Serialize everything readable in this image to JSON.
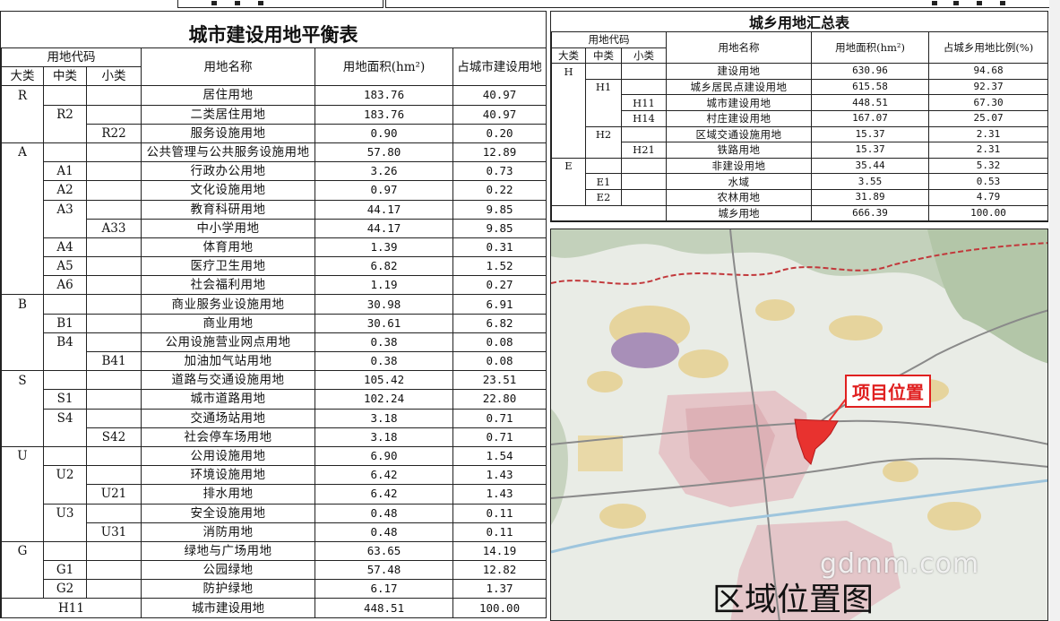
{
  "left_table": {
    "title": "城市建设用地平衡表",
    "header": {
      "code": "用地代码",
      "major": "大类",
      "medium": "中类",
      "minor": "小类",
      "name": "用地名称",
      "area": "用地面积(hm²)",
      "ratio": "占城市建设用地"
    },
    "rows": [
      {
        "major": "R",
        "medium": "",
        "minor": "",
        "name": "居住用地",
        "area": "183.76",
        "ratio": "40.97"
      },
      {
        "major": "",
        "medium": "R2",
        "minor": "",
        "name": "二类居住用地",
        "area": "183.76",
        "ratio": "40.97"
      },
      {
        "major": "",
        "medium": "",
        "minor": "R22",
        "name": "服务设施用地",
        "area": "0.90",
        "ratio": "0.20"
      },
      {
        "major": "A",
        "medium": "",
        "minor": "",
        "name": "公共管理与公共服务设施用地",
        "area": "57.80",
        "ratio": "12.89"
      },
      {
        "major": "",
        "medium": "A1",
        "minor": "",
        "name": "行政办公用地",
        "area": "3.26",
        "ratio": "0.73"
      },
      {
        "major": "",
        "medium": "A2",
        "minor": "",
        "name": "文化设施用地",
        "area": "0.97",
        "ratio": "0.22"
      },
      {
        "major": "",
        "medium": "A3",
        "minor": "",
        "name": "教育科研用地",
        "area": "44.17",
        "ratio": "9.85"
      },
      {
        "major": "",
        "medium": "",
        "minor": "A33",
        "name": "中小学用地",
        "area": "44.17",
        "ratio": "9.85"
      },
      {
        "major": "",
        "medium": "A4",
        "minor": "",
        "name": "体育用地",
        "area": "1.39",
        "ratio": "0.31"
      },
      {
        "major": "",
        "medium": "A5",
        "minor": "",
        "name": "医疗卫生用地",
        "area": "6.82",
        "ratio": "1.52"
      },
      {
        "major": "",
        "medium": "A6",
        "minor": "",
        "name": "社会福利用地",
        "area": "1.19",
        "ratio": "0.27"
      },
      {
        "major": "B",
        "medium": "",
        "minor": "",
        "name": "商业服务业设施用地",
        "area": "30.98",
        "ratio": "6.91"
      },
      {
        "major": "",
        "medium": "B1",
        "minor": "",
        "name": "商业用地",
        "area": "30.61",
        "ratio": "6.82"
      },
      {
        "major": "",
        "medium": "B4",
        "minor": "",
        "name": "公用设施营业网点用地",
        "area": "0.38",
        "ratio": "0.08"
      },
      {
        "major": "",
        "medium": "",
        "minor": "B41",
        "name": "加油加气站用地",
        "area": "0.38",
        "ratio": "0.08"
      },
      {
        "major": "S",
        "medium": "",
        "minor": "",
        "name": "道路与交通设施用地",
        "area": "105.42",
        "ratio": "23.51"
      },
      {
        "major": "",
        "medium": "S1",
        "minor": "",
        "name": "城市道路用地",
        "area": "102.24",
        "ratio": "22.80"
      },
      {
        "major": "",
        "medium": "S4",
        "minor": "",
        "name": "交通场站用地",
        "area": "3.18",
        "ratio": "0.71"
      },
      {
        "major": "",
        "medium": "",
        "minor": "S42",
        "name": "社会停车场用地",
        "area": "3.18",
        "ratio": "0.71"
      },
      {
        "major": "U",
        "medium": "",
        "minor": "",
        "name": "公用设施用地",
        "area": "6.90",
        "ratio": "1.54"
      },
      {
        "major": "",
        "medium": "U2",
        "minor": "",
        "name": "环境设施用地",
        "area": "6.42",
        "ratio": "1.43"
      },
      {
        "major": "",
        "medium": "",
        "minor": "U21",
        "name": "排水用地",
        "area": "6.42",
        "ratio": "1.43"
      },
      {
        "major": "",
        "medium": "U3",
        "minor": "",
        "name": "安全设施用地",
        "area": "0.48",
        "ratio": "0.11"
      },
      {
        "major": "",
        "medium": "",
        "minor": "U31",
        "name": "消防用地",
        "area": "0.48",
        "ratio": "0.11"
      },
      {
        "major": "G",
        "medium": "",
        "minor": "",
        "name": "绿地与广场用地",
        "area": "63.65",
        "ratio": "14.19"
      },
      {
        "major": "",
        "medium": "G1",
        "minor": "",
        "name": "公园绿地",
        "area": "57.48",
        "ratio": "12.82"
      },
      {
        "major": "",
        "medium": "G2",
        "minor": "",
        "name": "防护绿地",
        "area": "6.17",
        "ratio": "1.37"
      }
    ],
    "total": {
      "code": "H11",
      "name": "城市建设用地",
      "area": "448.51",
      "ratio": "100.00"
    }
  },
  "right_table": {
    "title": "城乡用地汇总表",
    "header": {
      "code": "用地代码",
      "major": "大类",
      "medium": "中类",
      "minor": "小类",
      "name": "用地名称",
      "area": "用地面积(hm²)",
      "ratio": "占城乡用地比例(%)"
    },
    "rows": [
      {
        "major": "H",
        "medium": "",
        "minor": "",
        "name": "建设用地",
        "area": "630.96",
        "ratio": "94.68"
      },
      {
        "major": "",
        "medium": "H1",
        "minor": "",
        "name": "城乡居民点建设用地",
        "area": "615.58",
        "ratio": "92.37"
      },
      {
        "major": "",
        "medium": "",
        "minor": "H11",
        "name": "城市建设用地",
        "area": "448.51",
        "ratio": "67.30"
      },
      {
        "major": "",
        "medium": "",
        "minor": "H14",
        "name": "村庄建设用地",
        "area": "167.07",
        "ratio": "25.07"
      },
      {
        "major": "",
        "medium": "H2",
        "minor": "",
        "name": "区域交通设施用地",
        "area": "15.37",
        "ratio": "2.31"
      },
      {
        "major": "",
        "medium": "",
        "minor": "H21",
        "name": "铁路用地",
        "area": "15.37",
        "ratio": "2.31"
      },
      {
        "major": "E",
        "medium": "",
        "minor": "",
        "name": "非建设用地",
        "area": "35.44",
        "ratio": "5.32"
      },
      {
        "major": "",
        "medium": "E1",
        "minor": "",
        "name": "水域",
        "area": "3.55",
        "ratio": "0.53"
      },
      {
        "major": "",
        "medium": "E2",
        "minor": "",
        "name": "农林用地",
        "area": "31.89",
        "ratio": "4.79"
      }
    ],
    "total": {
      "name": "城乡用地",
      "area": "666.39",
      "ratio": "100.00"
    }
  },
  "map": {
    "project_label": "项目位置",
    "caption": "区域位置图",
    "watermark": "gdmm.com",
    "colors": {
      "project": "#e8322f",
      "urban": "#e7c7c9",
      "village": "#e8d59a",
      "mountain": "#b7c8ae",
      "border": "#c2383b",
      "road": "#8a8a8a"
    }
  }
}
